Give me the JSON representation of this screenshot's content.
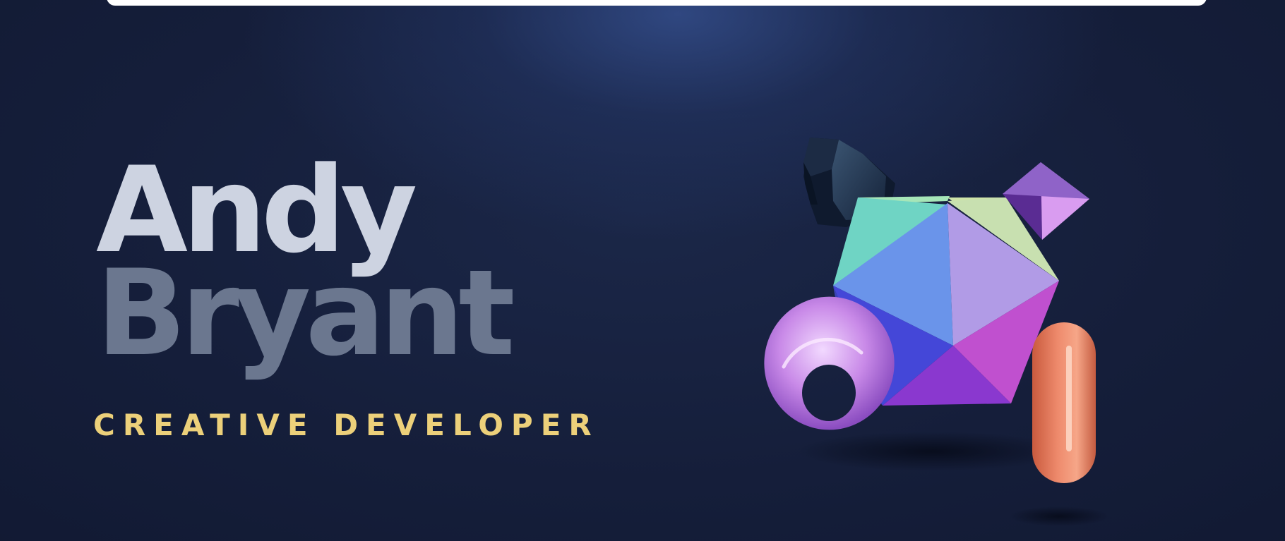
{
  "hero": {
    "first_name": "Andy",
    "last_name": "Bryant",
    "tagline": "CREATIVE DEVELOPER"
  },
  "theme": {
    "background": "#141d38",
    "first_name_color": "#cdd3e1",
    "last_name_color": "#6b778f",
    "tagline_color": "#ecd07a"
  },
  "scene": {
    "objects": [
      "dodecahedron",
      "icosahedron",
      "octahedron",
      "torus",
      "capsule"
    ]
  }
}
